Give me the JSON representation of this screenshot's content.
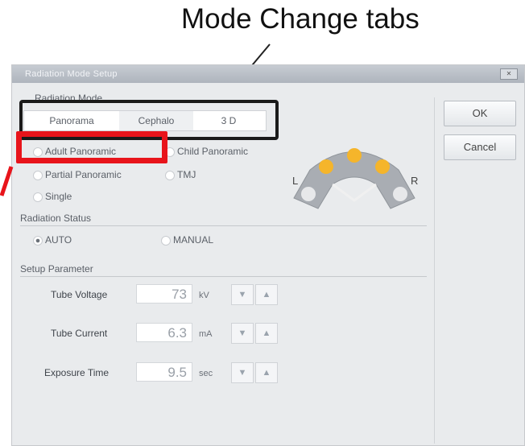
{
  "callout": {
    "text": "Mode Change tabs"
  },
  "dialog": {
    "title": "Radiation Mode Setup",
    "close_label": "✕",
    "radiation_mode": {
      "label": "Radiation Mode",
      "tabs": [
        "Panorama",
        "Cephalo",
        "3 D"
      ],
      "options": [
        "Adult Panoramic",
        "Child Panoramic",
        "Partial Panoramic",
        "TMJ",
        "Single"
      ]
    },
    "arch_labels": {
      "left": "L",
      "right": "R"
    },
    "radiation_status": {
      "label": "Radiation Status",
      "auto": "AUTO",
      "manual": "MANUAL"
    },
    "setup_parameter": {
      "label": "Setup Parameter",
      "rows": [
        {
          "name": "Tube Voltage",
          "value": "73",
          "unit": "kV"
        },
        {
          "name": "Tube Current",
          "value": "6.3",
          "unit": "mA"
        },
        {
          "name": "Exposure Time",
          "value": "9.5",
          "unit": "sec"
        }
      ],
      "down": "▼",
      "up": "▲"
    },
    "buttons": {
      "ok": "OK",
      "cancel": "Cancel"
    }
  },
  "colors": {
    "highlight_red": "#e8141b",
    "arch_gray": "#a9adb3",
    "sensor_orange": "#f5b52b"
  }
}
